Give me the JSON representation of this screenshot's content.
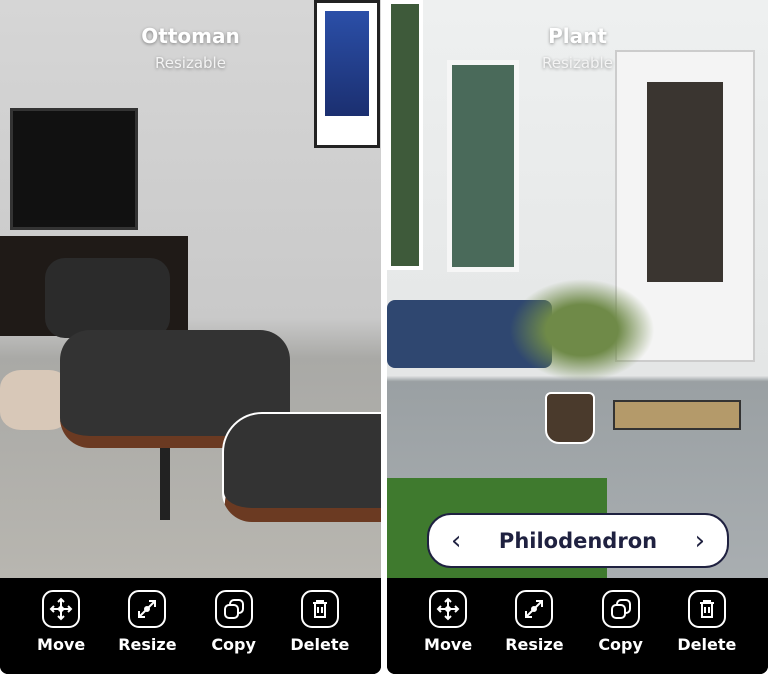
{
  "panels": [
    {
      "title": "Ottoman",
      "subtitle": "Resizable"
    },
    {
      "title": "Plant",
      "subtitle": "Resizable",
      "selector": {
        "label": "Philodendron",
        "prev_icon": "chevron-left-icon",
        "next_icon": "chevron-right-icon"
      }
    }
  ],
  "toolbar": {
    "move": "Move",
    "resize": "Resize",
    "copy": "Copy",
    "delete": "Delete"
  },
  "colors": {
    "selector_text": "#1f2140",
    "toolbar_bg": "#000000"
  }
}
